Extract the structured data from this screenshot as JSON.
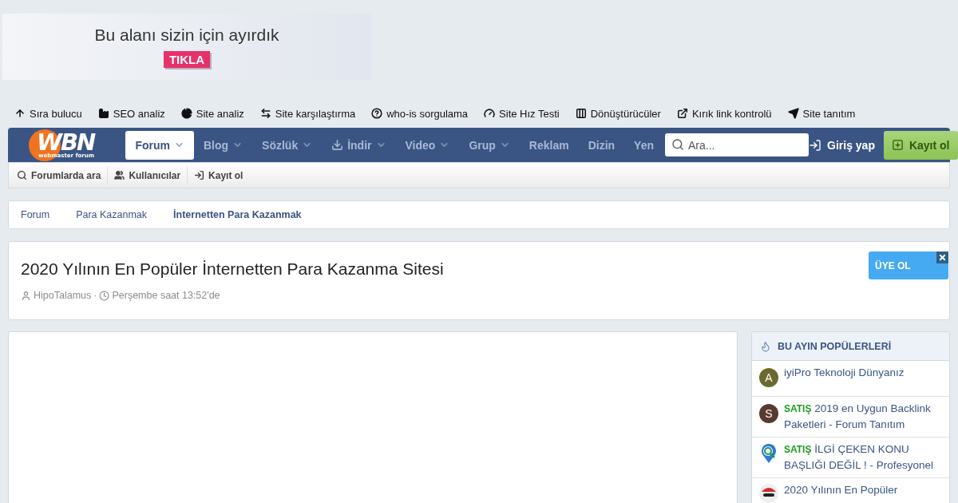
{
  "banner": {
    "headline": "Bu alanı sizin için ayırdık",
    "cta": "TIKLA"
  },
  "tools": [
    {
      "label": "Sıra bulucu"
    },
    {
      "label": "SEO analiz"
    },
    {
      "label": "Site analiz"
    },
    {
      "label": "Site karşılaştırma"
    },
    {
      "label": "who-is sorgulama"
    },
    {
      "label": "Site Hız Testi"
    },
    {
      "label": "Dönüştürücüler"
    },
    {
      "label": "Kırık link kontrolü"
    },
    {
      "label": "Site tanıtım"
    }
  ],
  "logo": {
    "text": "WBN",
    "tagline": "webmaster forum"
  },
  "nav": [
    {
      "label": "Forum",
      "selected": true,
      "dropdown": true
    },
    {
      "label": "Blog",
      "selected": false,
      "dropdown": true
    },
    {
      "label": "Sözlük",
      "selected": false,
      "dropdown": true
    },
    {
      "label": "İndir",
      "selected": false,
      "dropdown": true
    },
    {
      "label": "Video",
      "selected": false,
      "dropdown": true
    },
    {
      "label": "Grup",
      "selected": false,
      "dropdown": true
    },
    {
      "label": "Reklam",
      "selected": false,
      "dropdown": false
    },
    {
      "label": "Dizin",
      "selected": false,
      "dropdown": false
    },
    {
      "label": "Yen",
      "selected": false,
      "dropdown": false
    }
  ],
  "search": {
    "placeholder": "Ara..."
  },
  "login": "Giriş yap",
  "register": "Kayıt ol",
  "subnav": [
    {
      "label": "Forumlarda ara"
    },
    {
      "label": "Kullanıcılar"
    },
    {
      "label": "Kayıt ol"
    }
  ],
  "breadcrumbs": [
    {
      "label": "Forum",
      "current": false
    },
    {
      "label": "Para Kazanmak",
      "current": false
    },
    {
      "label": "İnternetten Para Kazanmak",
      "current": true
    }
  ],
  "thread": {
    "title": "2020 Yılının En Popüler İnternetten Para Kazanma Sitesi",
    "author": "HipoTalamus",
    "separator": "·",
    "date": "Perşembe saat 13:52'de"
  },
  "join_badge": {
    "label": "ÜYE OL"
  },
  "sidebar": {
    "title": "BU AYIN POPÜLERLERİ",
    "items": [
      {
        "avatar": {
          "kind": "letter",
          "letter": "A",
          "color": "#6b6a2e"
        },
        "title": "iyiPro Teknoloji Dünyanız"
      },
      {
        "avatar": {
          "kind": "letter",
          "letter": "S",
          "color": "#5a3a30"
        },
        "prefix": "SATIŞ",
        "title": "2019 en Uygun Backlink Paketleri - Forum Tanıtım"
      },
      {
        "avatar": {
          "kind": "pin"
        },
        "prefix": "SATIŞ",
        "title": "İLGİ ÇEKEN KONU BAŞLIĞI DEĞİL ! - Profesyonel"
      },
      {
        "avatar": {
          "kind": "figure"
        },
        "title": "2020 Yılının En Popüler"
      }
    ]
  }
}
